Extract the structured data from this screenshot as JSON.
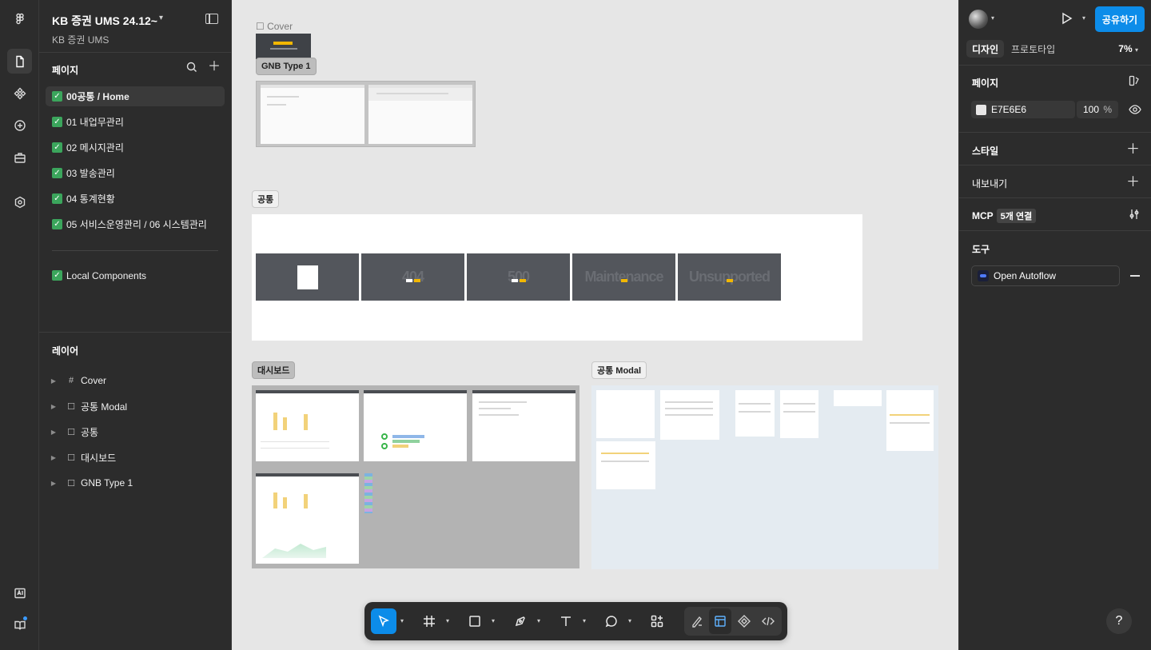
{
  "file": {
    "title": "KB 증권 UMS 24.12~",
    "project": "KB 증권 UMS"
  },
  "pages": {
    "label": "페이지",
    "items": [
      {
        "label": "00공통 / Home",
        "active": true
      },
      {
        "label": "01 내업무관리",
        "active": false
      },
      {
        "label": "02 메시지관리",
        "active": false
      },
      {
        "label": "03 발송관리",
        "active": false
      },
      {
        "label": "04 통계현황",
        "active": false
      },
      {
        "label": "05 서비스운영관리 / 06 시스템관리",
        "active": false
      },
      {
        "label": "Local Components",
        "active": false
      }
    ]
  },
  "layers": {
    "label": "레이어",
    "items": [
      {
        "label": "Cover",
        "icon": "frame-icon"
      },
      {
        "label": "공통 Modal",
        "icon": "section-icon"
      },
      {
        "label": "공통",
        "icon": "section-icon"
      },
      {
        "label": "대시보드",
        "icon": "section-icon"
      },
      {
        "label": "GNB Type 1",
        "icon": "section-icon"
      }
    ]
  },
  "canvas": {
    "cover_label": "Cover",
    "sections": {
      "gnb": "GNB Type 1",
      "common": "공통",
      "dashboard": "대시보드",
      "common_modal": "공통 Modal"
    },
    "error_pages": [
      "404",
      "500",
      "Maintenance",
      "Unsupported"
    ]
  },
  "right_panel": {
    "share_label": "공유하기",
    "tabs": {
      "design": "디자인",
      "prototype": "프로토타입"
    },
    "zoom": "7%",
    "page": {
      "label": "페이지",
      "color_hex": "E7E6E6",
      "opacity": "100",
      "opacity_unit": "%"
    },
    "style_label": "스타일",
    "export_label": "내보내기",
    "mcp": {
      "label": "MCP",
      "badge": "5개 연결"
    },
    "tools": {
      "label": "도구",
      "plugin": "Open Autoflow"
    }
  },
  "toolbar": {
    "tools": [
      "move",
      "frame",
      "shape",
      "pen",
      "text",
      "comment",
      "actions"
    ]
  },
  "help_label": "?"
}
